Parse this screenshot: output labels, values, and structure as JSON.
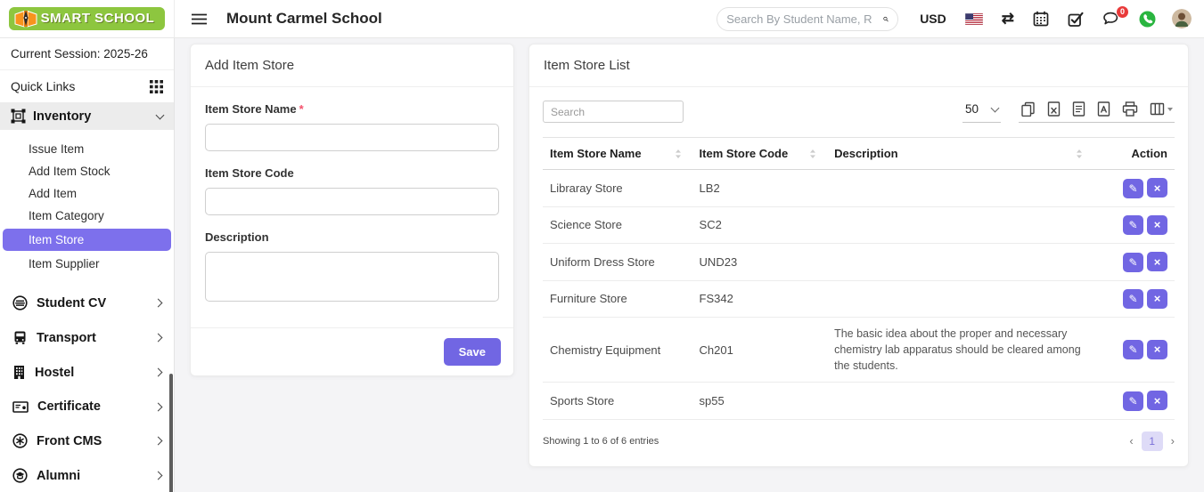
{
  "header": {
    "brand": "SMART SCHOOL",
    "school_name": "Mount Carmel School",
    "search_placeholder": "Search By Student Name, R",
    "currency": "USD",
    "chat_badge": "0"
  },
  "icons": {
    "exchange": "⇄",
    "edit": "✎",
    "delete": "×",
    "prev": "‹",
    "next": "›"
  },
  "colors": {
    "accent": "#7166e3",
    "sidebar_active": "#7d70ec",
    "logo_green": "#8dc63f",
    "logo_orange": "#f7941d",
    "badge_red": "#e93a3a",
    "whatsapp_green": "#2ab540",
    "page_current_bg": "#dedbf7"
  },
  "sidebar": {
    "session_label": "Current Session: 2025-26",
    "quick_links_label": "Quick Links",
    "inventory": {
      "label": "Inventory",
      "items": [
        "Issue Item",
        "Add Item Stock",
        "Add Item",
        "Item Category",
        "Item Store",
        "Item Supplier"
      ],
      "active_item": "Item Store"
    },
    "sections": [
      {
        "label": "Student CV"
      },
      {
        "label": "Transport"
      },
      {
        "label": "Hostel"
      },
      {
        "label": "Certificate"
      },
      {
        "label": "Front CMS"
      },
      {
        "label": "Alumni"
      }
    ]
  },
  "form": {
    "title": "Add Item Store",
    "name_label": "Item Store Name",
    "required_marker": "*",
    "code_label": "Item Store Code",
    "description_label": "Description",
    "save_label": "Save"
  },
  "list": {
    "title": "Item Store List",
    "search_placeholder": "Search",
    "page_size": "50",
    "columns": [
      "Item Store Name",
      "Item Store Code",
      "Description",
      "Action"
    ],
    "rows": [
      {
        "name": "Libraray Store",
        "code": "LB2",
        "description": ""
      },
      {
        "name": "Science Store",
        "code": "SC2",
        "description": ""
      },
      {
        "name": "Uniform Dress Store",
        "code": "UND23",
        "description": ""
      },
      {
        "name": "Furniture Store",
        "code": "FS342",
        "description": ""
      },
      {
        "name": "Chemistry Equipment",
        "code": "Ch201",
        "description": "The basic idea about the proper and necessary chemistry lab apparatus should be cleared among the students."
      },
      {
        "name": "Sports Store",
        "code": "sp55",
        "description": ""
      }
    ],
    "footer_text": "Showing 1 to 6 of 6 entries",
    "current_page": "1"
  }
}
